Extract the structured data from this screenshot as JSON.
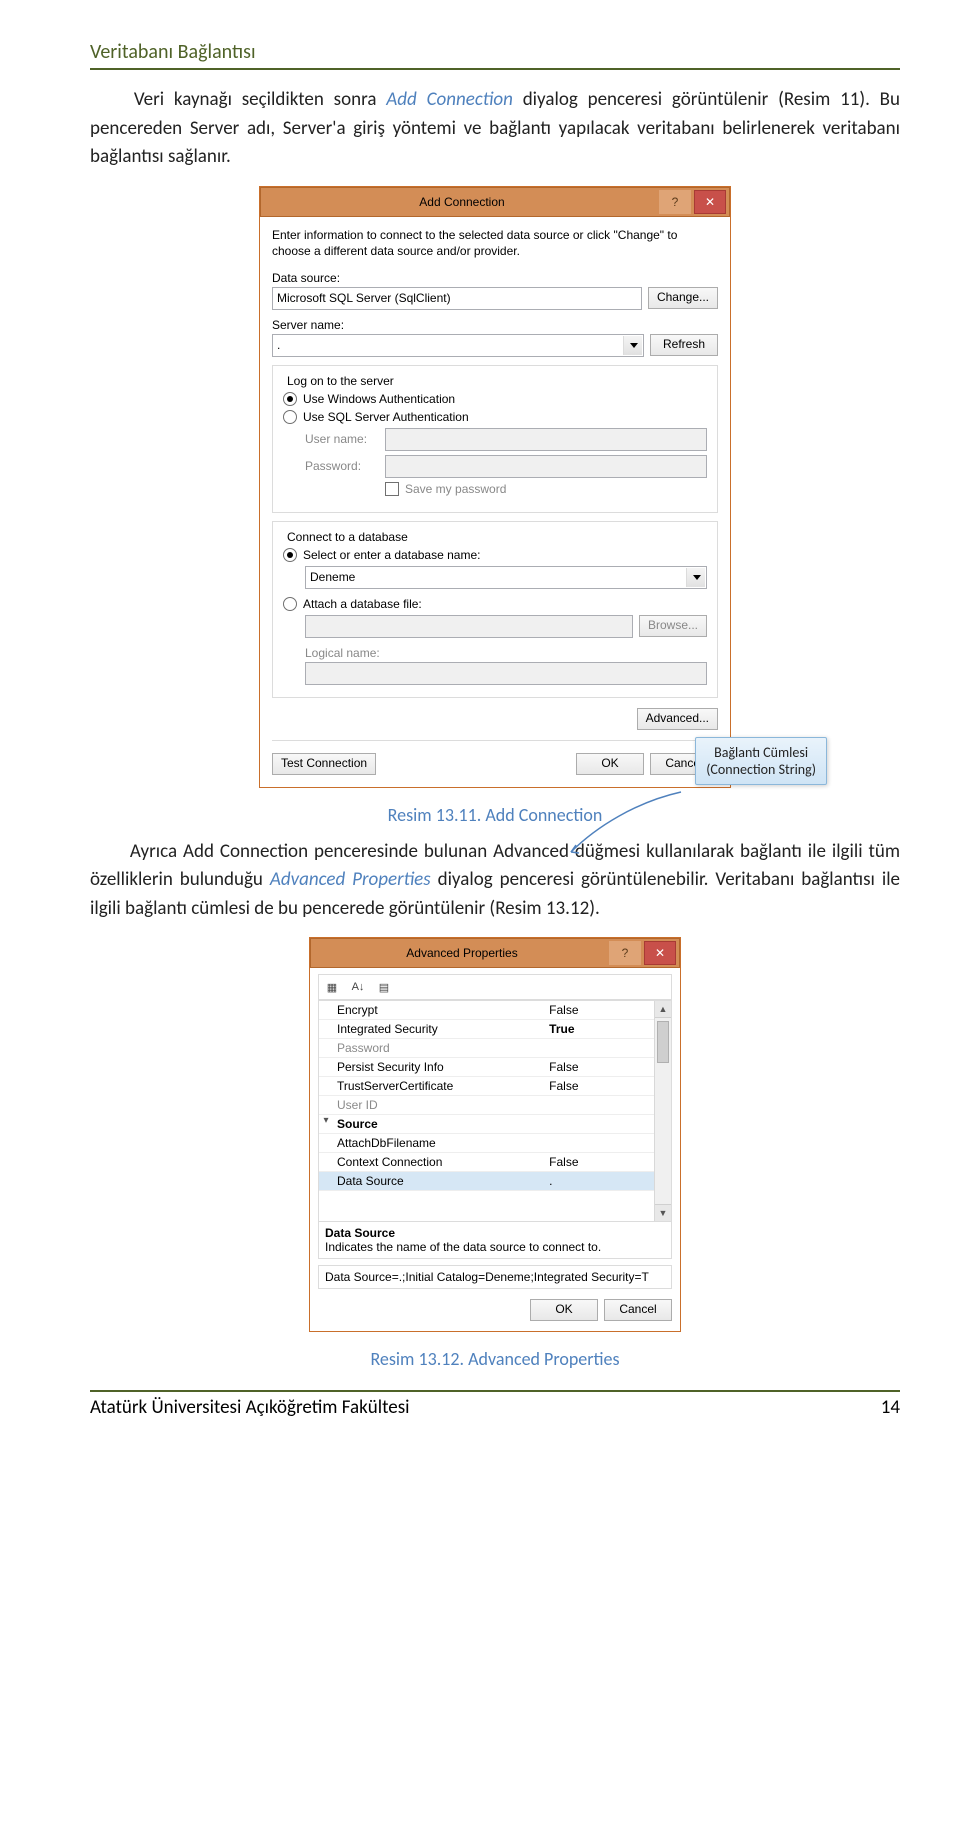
{
  "page": {
    "header": "Veritabanı Bağlantısı",
    "para1_pre": "Veri kaynağı seçildikten sonra ",
    "para1_em": "Add Connection",
    "para1_post": " diyalog penceresi görüntülenir (Resim 11). Bu pencereden Server adı, Server'a giriş yöntemi ve bağlantı yapılacak veritabanı belirlenerek veritabanı bağlantısı sağlanır.",
    "caption1": "Resim 13.11. Add Connection",
    "para2_a": "Ayrıca Add Connection penceresinde bulunan Advanced düğmesi kullanılarak bağlantı ile ilgili tüm özelliklerin bulunduğu ",
    "para2_em": "Advanced Properties",
    "para2_b": " diyalog penceresi görüntülenebilir. Veritabanı bağlantısı ile ilgili bağlantı cümlesi de bu pencerede görüntülenir (Resim 13.12).",
    "caption2": "Resim 13.12. Advanced Properties",
    "footer_left": "Atatürk Üniversitesi Açıköğretim Fakültesi",
    "footer_right": "14"
  },
  "callout": {
    "line1": "Bağlantı Cümlesi",
    "line2": "(Connection String)"
  },
  "dlg1": {
    "title": "Add Connection",
    "help": "?",
    "close": "✕",
    "desc": "Enter information to connect to the selected data source or click \"Change\" to choose a different data source and/or provider.",
    "datasource_lbl": "Data source:",
    "datasource_val": "Microsoft SQL Server (SqlClient)",
    "change_btn": "Change...",
    "server_lbl": "Server name:",
    "server_val": ".",
    "refresh_btn": "Refresh",
    "logon_title": "Log on to the server",
    "radio_win": "Use Windows Authentication",
    "radio_sql": "Use SQL Server Authentication",
    "user_lbl": "User name:",
    "pass_lbl": "Password:",
    "savepw": "Save my password",
    "connectdb_title": "Connect to a database",
    "radio_selectdb": "Select or enter a database name:",
    "db_val": "Deneme",
    "radio_attach": "Attach a database file:",
    "browse_btn": "Browse...",
    "logical_lbl": "Logical name:",
    "advanced_btn": "Advanced...",
    "test_btn": "Test Connection",
    "ok_btn": "OK",
    "cancel_btn": "Cancel"
  },
  "dlg2": {
    "title": "Advanced Properties",
    "help": "?",
    "close": "✕",
    "toolbar": {
      "i1": "▦",
      "i2": "A↓",
      "i3": "▤"
    },
    "rows": [
      {
        "k": "Encrypt",
        "v": "False"
      },
      {
        "k": "Integrated Security",
        "v": "True",
        "bold": true
      },
      {
        "k": "Password",
        "v": "",
        "muted": true
      },
      {
        "k": "Persist Security Info",
        "v": "False"
      },
      {
        "k": "TrustServerCertificate",
        "v": "False"
      },
      {
        "k": "User ID",
        "v": "",
        "muted": true
      }
    ],
    "cat": "Source",
    "rows2": [
      {
        "k": "AttachDbFilename",
        "v": ""
      },
      {
        "k": "Context Connection",
        "v": "False"
      },
      {
        "k": "Data Source",
        "v": "."
      }
    ],
    "desc_title": "Data Source",
    "desc_text": "Indicates the name of the data source to connect to.",
    "conn_string": "Data Source=.;Initial Catalog=Deneme;Integrated Security=T",
    "ok": "OK",
    "cancel": "Cancel"
  }
}
